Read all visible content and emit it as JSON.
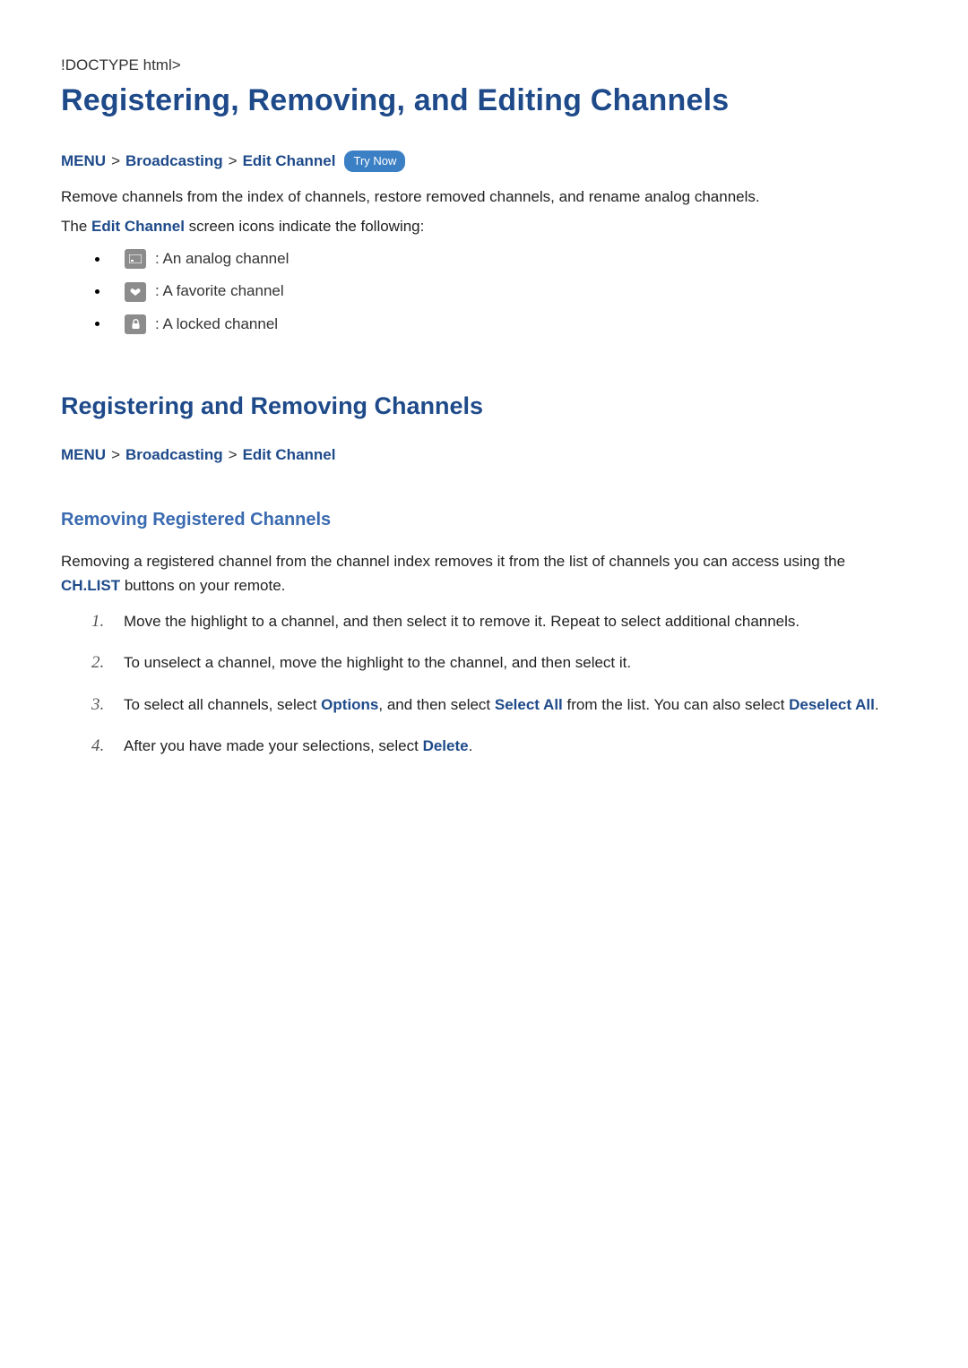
{
  "title_main": "Registering, Removing, and Editing Channels",
  "bc1": {
    "menu": "MENU",
    "broadcasting": "Broadcasting",
    "edit": "Edit Channel",
    "try_now": "Try Now"
  },
  "intro_line1": "Remove channels from the index of channels, restore removed channels, and rename analog channels.",
  "intro_line2_pre": "The ",
  "intro_line2_term": "Edit Channel",
  "intro_line2_post": " screen icons indicate the following:",
  "icons": {
    "analog": " : An analog channel",
    "favorite": " : A favorite channel",
    "locked": " : A locked channel"
  },
  "h2_register": "Registering and Removing Channels",
  "bc2": {
    "menu": "MENU",
    "broadcasting": "Broadcasting",
    "edit": "Edit Channel"
  },
  "h3_removing": "Removing Registered Channels",
  "remove_para_pre": "Removing a registered channel from the channel index removes it from the list of channels you can access using the ",
  "remove_para_term": "CH.LIST",
  "remove_para_post": " buttons on your remote.",
  "steps": {
    "s1": "Move the highlight to a channel, and then select it to remove it. Repeat to select additional channels.",
    "s2": "To unselect a channel, move the highlight to the channel, and then select it.",
    "s3_a": "To select all channels, select ",
    "s3_opt": "Options",
    "s3_b": ", and then select ",
    "s3_sel": "Select All",
    "s3_c": " from the list. You can also select ",
    "s3_desel": "Deselect All",
    "s3_d": ".",
    "s4_a": "After you have made your selections, select ",
    "s4_del": "Delete",
    "s4_b": "."
  }
}
